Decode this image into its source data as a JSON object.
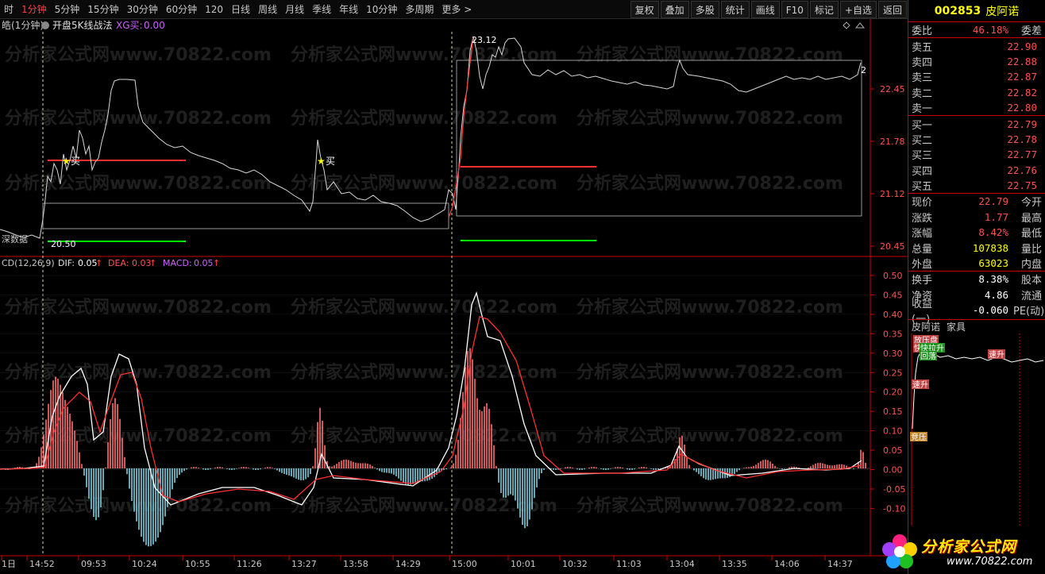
{
  "toolbar": {
    "periods": [
      {
        "label": "时",
        "active": false
      },
      {
        "label": "1分钟",
        "active": true
      },
      {
        "label": "5分钟",
        "active": false
      },
      {
        "label": "15分钟",
        "active": false
      },
      {
        "label": "30分钟",
        "active": false
      },
      {
        "label": "60分钟",
        "active": false
      },
      {
        "label": "120",
        "active": false
      },
      {
        "label": "日线",
        "active": false
      },
      {
        "label": "周线",
        "active": false
      },
      {
        "label": "月线",
        "active": false
      },
      {
        "label": "季线",
        "active": false
      },
      {
        "label": "年线",
        "active": false
      },
      {
        "label": "10分钟",
        "active": false
      },
      {
        "label": "多周期",
        "active": false
      },
      {
        "label": "更多 >",
        "active": false
      }
    ],
    "tools": [
      "复权",
      "叠加",
      "多股",
      "统计",
      "画线",
      "F10",
      "标记",
      "+自选",
      "返回"
    ]
  },
  "main_chart": {
    "title": "皓(1分钟)",
    "indicator": "开盘5K线战法",
    "xg_label": "XG买:",
    "xg_value": "0.00",
    "label_buy": "买",
    "label_top": "23.12",
    "label_low": "20.50",
    "label_side": "深数据",
    "label_right": "2",
    "price_ticks": [
      "22.45",
      "21.78",
      "21.12",
      "20.45"
    ]
  },
  "macd": {
    "name": "CD(12,26,9)",
    "dif_label": "DIF:",
    "dif_value": "0.05",
    "dea_label": "DEA:",
    "dea_value": "0.03",
    "macd_label": "MACD:",
    "macd_value": "0.05",
    "ticks": [
      "0.50",
      "0.45",
      "0.40",
      "0.35",
      "0.30",
      "0.25",
      "0.20",
      "0.15",
      "0.10",
      "0.05",
      "0.00",
      "-0.05",
      "-0.10"
    ]
  },
  "time_axis": [
    "1日",
    "14:52",
    "09:53",
    "10:24",
    "10:55",
    "11:26",
    "13:27",
    "13:58",
    "14:29",
    "15:00",
    "10:01",
    "10:32",
    "11:03",
    "13:04",
    "13:35",
    "14:06",
    "14:37"
  ],
  "watermark": "分析家公式网www.70822.com",
  "stock": {
    "code": "002853",
    "name": "皮阿诺",
    "weibi_label": "委比",
    "weibi_value": "46.18%",
    "weicha_label": "委差",
    "asks": [
      {
        "label": "卖五",
        "price": "22.90"
      },
      {
        "label": "卖四",
        "price": "22.88"
      },
      {
        "label": "卖三",
        "price": "22.87"
      },
      {
        "label": "卖二",
        "price": "22.82"
      },
      {
        "label": "卖一",
        "price": "22.80"
      }
    ],
    "bids": [
      {
        "label": "买一",
        "price": "22.79"
      },
      {
        "label": "买二",
        "price": "22.78"
      },
      {
        "label": "买三",
        "price": "22.77"
      },
      {
        "label": "买四",
        "price": "22.76"
      },
      {
        "label": "买五",
        "price": "22.75"
      }
    ],
    "quote": [
      {
        "label": "现价",
        "value": "22.79",
        "label2": "今开",
        "color": "red"
      },
      {
        "label": "涨跌",
        "value": "1.77",
        "label2": "最高",
        "color": "red"
      },
      {
        "label": "涨幅",
        "value": "8.42%",
        "label2": "最低",
        "color": "red"
      },
      {
        "label": "总量",
        "value": "107838",
        "label2": "量比",
        "color": "yellow"
      },
      {
        "label": "外盘",
        "value": "63023",
        "label2": "内盘",
        "color": "yellow"
      }
    ],
    "extra": [
      {
        "label": "换手",
        "value": "8.38%",
        "label2": "股本"
      },
      {
        "label": "净资",
        "value": "4.86",
        "label2": "流通"
      },
      {
        "label": "收益(一)",
        "value": "-0.060",
        "label2": "PE(动)"
      }
    ],
    "mini_tabs": [
      "皮阿诺",
      "家具"
    ],
    "mini_tags": [
      "放压盘",
      "快拉升",
      "快拉升",
      "回落",
      "速升",
      "速升",
      "竞压"
    ]
  },
  "logo": {
    "text": "分析家公式网",
    "url": "www.70822.com"
  }
}
